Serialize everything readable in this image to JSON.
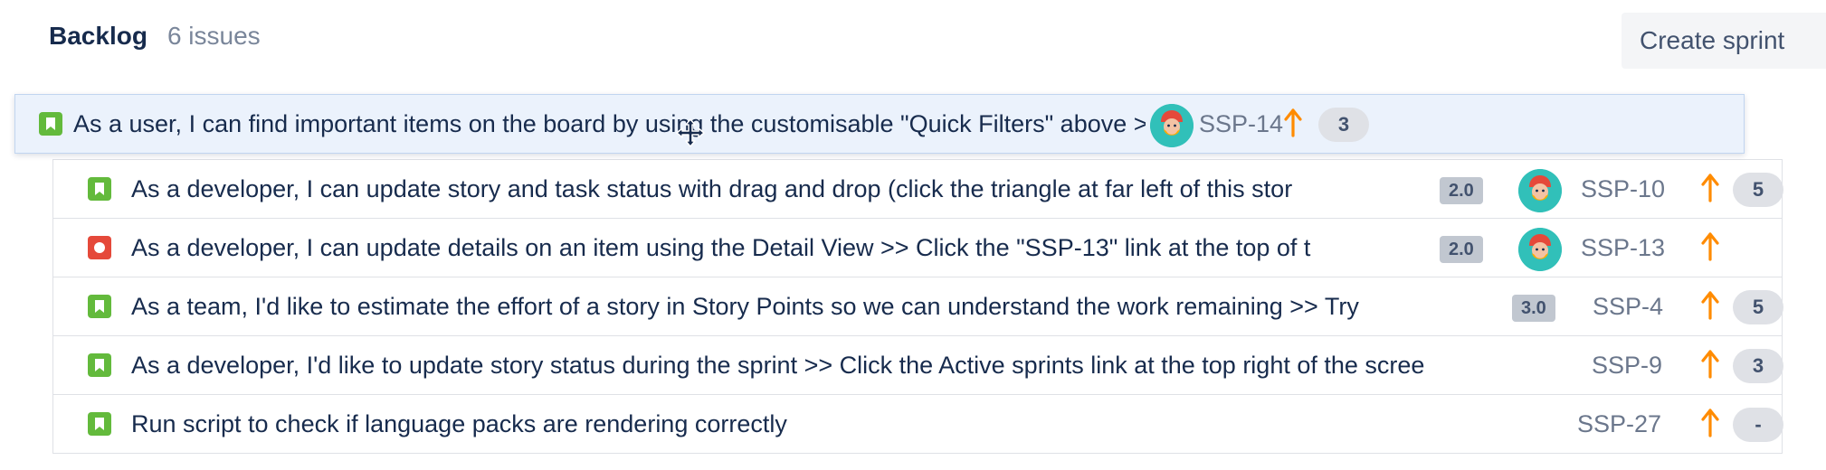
{
  "backlog": {
    "title": "Backlog",
    "count_label": "6 issues",
    "create_sprint_label": "Create sprint"
  },
  "colors": {
    "story": "#63ba3c",
    "bug": "#e5493a",
    "priority_high": "#ff8b00",
    "avatar_bg": "#31c0b9",
    "drag_highlight": "#ebf2fc"
  },
  "dragging_issue": {
    "type": "story",
    "type_icon": "story-icon",
    "summary": "As a user, I can find important items on the board by using the customisable \"Quick Filters\" above >> Try clicking th",
    "assignee_icon": "avatar",
    "key": "SSP-14",
    "priority_icon": "priority-high-arrow-icon",
    "story_points": "3"
  },
  "issues": [
    {
      "type": "story",
      "type_icon": "story-icon",
      "summary": "As a developer, I can update story and task status with drag and drop (click the triangle at far left of this stor",
      "estimate": "2.0",
      "assignee_icon": "avatar",
      "key": "SSP-10",
      "priority_icon": "priority-high-arrow-icon",
      "story_points": "5"
    },
    {
      "type": "bug",
      "type_icon": "bug-icon",
      "summary": "As a developer, I can update details on an item using the Detail View >> Click the \"SSP-13\" link at the top of t",
      "estimate": "2.0",
      "assignee_icon": "avatar",
      "key": "SSP-13",
      "priority_icon": "priority-high-arrow-icon",
      "story_points": ""
    },
    {
      "type": "story",
      "type_icon": "story-icon",
      "summary": "As a team, I'd like to estimate the effort of a story in Story Points so we can understand the work remaining >> Try",
      "estimate": "3.0",
      "key": "SSP-4",
      "priority_icon": "priority-high-arrow-icon",
      "story_points": "5"
    },
    {
      "type": "story",
      "type_icon": "story-icon",
      "summary": "As a developer, I'd like to update story status during the sprint >> Click the Active sprints link at the top right of the scree",
      "key": "SSP-9",
      "priority_icon": "priority-high-arrow-icon",
      "story_points": "3"
    },
    {
      "type": "story",
      "type_icon": "story-icon",
      "summary": "Run script to check if language packs are rendering correctly",
      "key": "SSP-27",
      "priority_icon": "priority-high-arrow-icon",
      "story_points": "-"
    }
  ],
  "cursor_icon": "move-cursor-icon"
}
